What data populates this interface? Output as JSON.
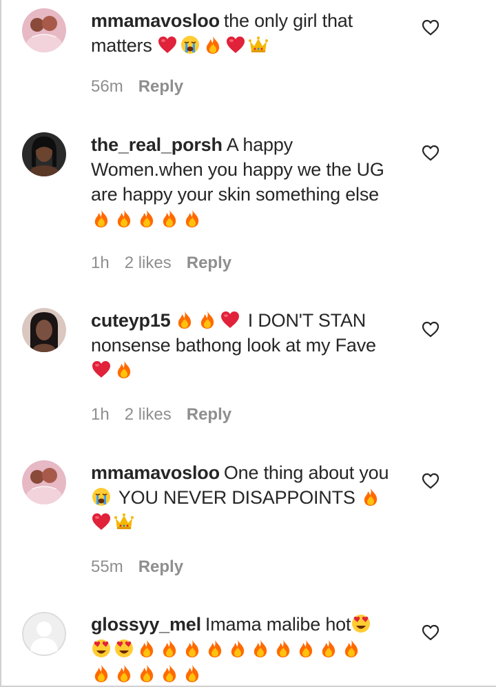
{
  "comments": [
    {
      "username": "mmamavosloo",
      "text": "the only girl that matters",
      "emojis": [
        "heart",
        "sob",
        "fire",
        "heart",
        "crown"
      ],
      "time": "56m",
      "likes": "",
      "reply_label": "Reply",
      "avatar": "photo-pink"
    },
    {
      "username": "the_real_porsh",
      "text": "A happy Women.when you happy we the UG are happy your skin something else",
      "emojis": [
        "fire",
        "fire",
        "fire",
        "fire",
        "fire"
      ],
      "time": "1h",
      "likes": "2 likes",
      "reply_label": "Reply",
      "avatar": "photo-dark"
    },
    {
      "username": "cuteyp15",
      "text_pre_emojis": [
        "fire",
        "fire",
        "heart"
      ],
      "text": "I DON'T STAN nonsense bathong look at my Fave",
      "emojis": [
        "heart",
        "fire"
      ],
      "time": "1h",
      "likes": "2 likes",
      "reply_label": "Reply",
      "avatar": "photo-dark"
    },
    {
      "username": "mmamavosloo",
      "text_part1": "One thing about you",
      "text_part2": "YOU NEVER DISAPPOINTS",
      "emojis_mid": [
        "sob"
      ],
      "emojis_after2": [
        "fire"
      ],
      "emojis": [
        "heart",
        "crown"
      ],
      "time": "55m",
      "likes": "",
      "reply_label": "Reply",
      "avatar": "photo-pink"
    },
    {
      "username": "glossyy_mel",
      "text": "Imama malibe hot",
      "emojis": [
        "heart-eyes"
      ],
      "emojis_line2": [
        "heart-eyes",
        "heart-eyes",
        "fire",
        "fire",
        "fire",
        "fire",
        "fire",
        "fire",
        "fire",
        "fire",
        "fire",
        "fire"
      ],
      "emojis_line3": [
        "fire",
        "fire",
        "fire",
        "fire",
        "fire"
      ],
      "avatar": "default-avatar"
    }
  ],
  "icons": {
    "like": "heart-outline-icon"
  },
  "colors": {
    "text": "#262626",
    "meta": "#8e8e8e",
    "fire": "#ff6a00",
    "heart": "#e0223a",
    "crown": "#f5b800"
  }
}
